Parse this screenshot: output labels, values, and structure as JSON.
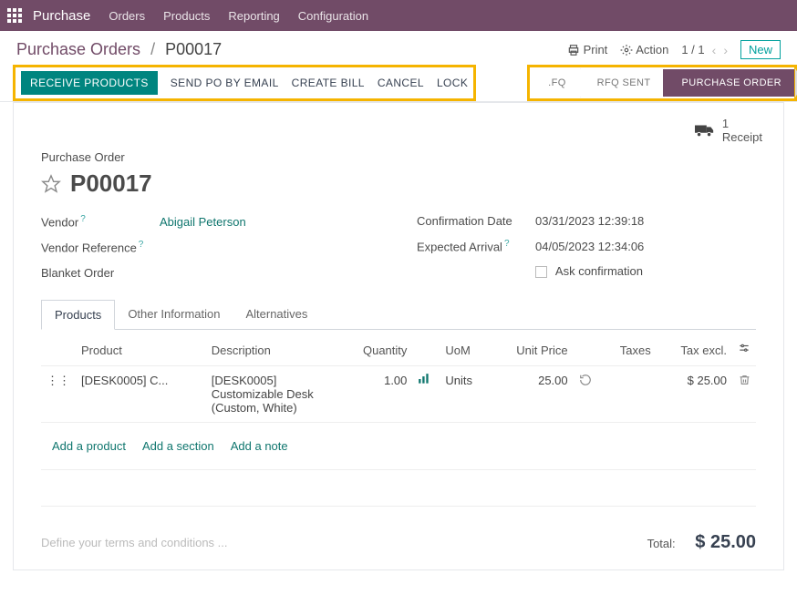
{
  "topnav": {
    "brand": "Purchase",
    "menu": [
      "Orders",
      "Products",
      "Reporting",
      "Configuration"
    ]
  },
  "breadcrumb": {
    "root": "Purchase Orders",
    "current": "P00017"
  },
  "header_actions": {
    "print": "Print",
    "action": "Action",
    "pager": "1 / 1",
    "new": "New"
  },
  "buttons": {
    "receive": "RECEIVE PRODUCTS",
    "send_po": "SEND PO BY EMAIL",
    "create_bill": "CREATE BILL",
    "cancel": "CANCEL",
    "lock": "LOCK"
  },
  "status": {
    "rfq_short": ".FQ",
    "rfq_sent": "RFQ SENT",
    "purchase_order": "PURCHASE ORDER"
  },
  "receipt": {
    "count": "1",
    "label": "Receipt"
  },
  "po": {
    "caption": "Purchase Order",
    "name": "P00017",
    "vendor_label": "Vendor",
    "vendor": "Abigail Peterson",
    "vendor_ref_label": "Vendor Reference",
    "blanket_label": "Blanket Order",
    "confirm_label": "Confirmation Date",
    "confirm_value": "03/31/2023 12:39:18",
    "expected_label": "Expected Arrival",
    "expected_value": "04/05/2023 12:34:06",
    "ask_confirm": "Ask confirmation"
  },
  "tabs": {
    "products": "Products",
    "other": "Other Information",
    "alt": "Alternatives"
  },
  "table": {
    "headers": {
      "product": "Product",
      "description": "Description",
      "quantity": "Quantity",
      "uom": "UoM",
      "unit_price": "Unit Price",
      "taxes": "Taxes",
      "tax_excl": "Tax excl."
    },
    "row": {
      "product": "[DESK0005] C...",
      "description": "[DESK0005] Customizable Desk (Custom, White)",
      "quantity": "1.00",
      "uom": "Units",
      "unit_price": "25.00",
      "tax_excl": "$ 25.00"
    },
    "add_product": "Add a product",
    "add_section": "Add a section",
    "add_note": "Add a note"
  },
  "footer": {
    "terms_placeholder": "Define your terms and conditions ...",
    "total_label": "Total:",
    "total_value": "$ 25.00"
  }
}
